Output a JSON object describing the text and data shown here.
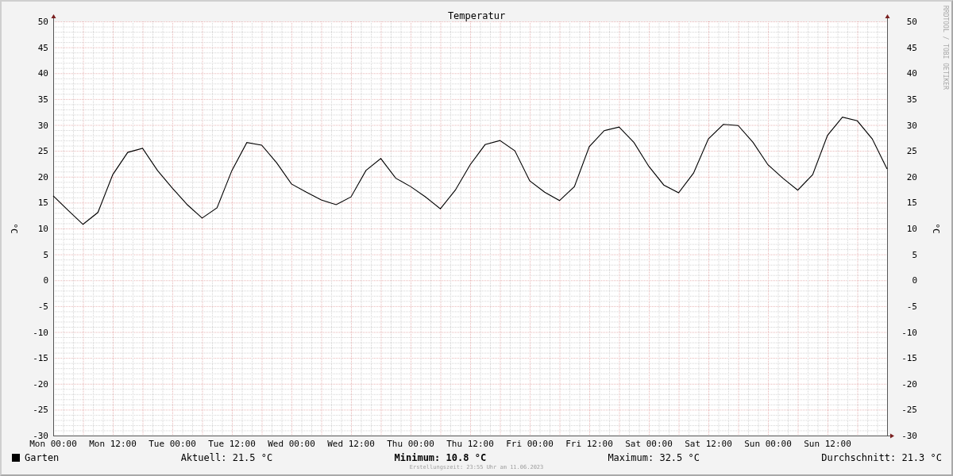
{
  "graph": {
    "chart_data": {
      "type": "line",
      "title": "Temperatur",
      "ylabel": "°C",
      "categories": [
        "Mon 00:00",
        null,
        null,
        null,
        "Mon 12:00",
        null,
        null,
        null,
        "Tue 00:00",
        null,
        null,
        null,
        "Tue 12:00",
        null,
        null,
        null,
        "Wed 00:00",
        null,
        null,
        null,
        "Wed 12:00",
        null,
        null,
        null,
        "Thu 00:00",
        null,
        null,
        null,
        "Thu 12:00",
        null,
        null,
        null,
        "Fri 00:00",
        null,
        null,
        null,
        "Fri 12:00",
        null,
        null,
        null,
        "Sat 00:00",
        null,
        null,
        null,
        "Sat 12:00",
        null,
        null,
        null,
        "Sun 00:00",
        null,
        null,
        null,
        "Sun 12:00",
        null,
        null,
        null,
        null
      ],
      "series": [
        {
          "name": "Garten",
          "color": "#000000",
          "values": [
            16.3,
            13.5,
            10.8,
            13.1,
            20.4,
            24.7,
            25.5,
            21.2,
            17.8,
            14.6,
            12.0,
            14.0,
            21.2,
            26.6,
            26.1,
            22.7,
            18.6,
            17.0,
            15.5,
            14.6,
            16.1,
            21.2,
            23.5,
            19.7,
            18.1,
            16.1,
            13.8,
            17.4,
            22.3,
            26.2,
            27.0,
            25.0,
            19.2,
            17.0,
            15.4,
            18.1,
            25.8,
            28.9,
            29.6,
            26.6,
            22.0,
            18.4,
            16.9,
            20.7,
            27.3,
            30.1,
            29.9,
            26.6,
            22.3,
            19.7,
            17.4,
            20.4,
            28.0,
            31.5,
            30.8,
            27.3,
            21.5
          ]
        }
      ],
      "ylim": [
        -30,
        50
      ],
      "grid": true,
      "yticks": [
        50,
        45,
        40,
        35,
        30,
        25,
        20,
        15,
        10,
        5,
        0,
        -5,
        -10,
        -15,
        -20,
        -25,
        -30
      ]
    },
    "right_axis_label": "°C",
    "right_axis_ticks": [
      "50",
      "45",
      "40",
      "35",
      "30",
      "25",
      "20",
      "15",
      "10",
      "5",
      "0",
      "-5",
      "-10",
      "-15",
      "-20",
      "-25",
      "-30"
    ],
    "credit": "RRDTOOL / TOBI OETIKER"
  },
  "legend": {
    "stats": [
      {
        "label": "Aktuell:",
        "value": "21.5 °C",
        "emphasized": false
      },
      {
        "label": "Minimum:",
        "value": "10.8 °C",
        "emphasized": true
      },
      {
        "label": "Maximum:",
        "value": "32.5 °C",
        "emphasized": false
      },
      {
        "label": "Durchschnitt:",
        "value": "21.3 °C",
        "emphasized": false
      }
    ]
  },
  "footer": "Erstellungszeit: 23:55 Uhr am 11.06.2023"
}
